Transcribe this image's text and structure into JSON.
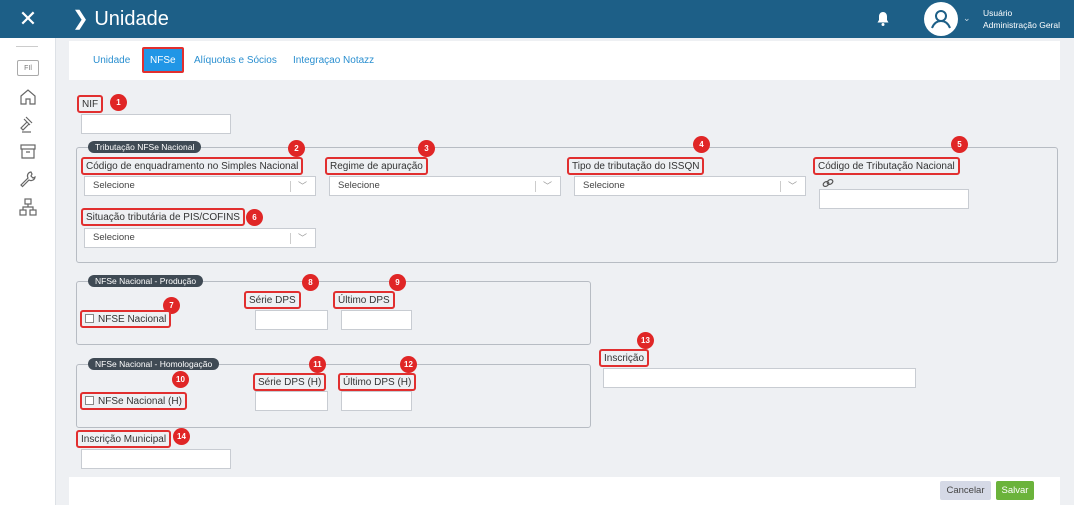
{
  "header": {
    "title": "Unidade",
    "user_name": "Usuário",
    "user_role": "Administração Geral"
  },
  "sidebar": {
    "fil_label": "FIl",
    "icons": [
      "home-icon",
      "gavel-icon",
      "archive-icon",
      "wrench-icon",
      "network-icon"
    ]
  },
  "tabs": [
    {
      "label": "Unidade"
    },
    {
      "label": "NFSe",
      "active": true
    },
    {
      "label": "Alíquotas e Sócios"
    },
    {
      "label": "Integraçao Notazz"
    }
  ],
  "form": {
    "nif": {
      "label": "NIF",
      "badge": "1",
      "value": ""
    },
    "tributacao": {
      "legend": "Tributação NFSe Nacional",
      "enquadramento": {
        "label": "Código de enquadramento no Simples Nacional",
        "badge": "2",
        "selected": "Selecione"
      },
      "regime": {
        "label": "Regime de apuração",
        "badge": "3",
        "selected": "Selecione"
      },
      "tipo_issqn": {
        "label": "Tipo de tributação do ISSQN",
        "badge": "4",
        "selected": "Selecione"
      },
      "codigo_nacional": {
        "label": "Código de Tributação Nacional",
        "badge": "5",
        "value": ""
      },
      "situacao_pis": {
        "label": "Situação tributária de PIS/COFINS",
        "badge": "6",
        "selected": "Selecione"
      }
    },
    "producao": {
      "legend": "NFSe Nacional - Produção",
      "nfse_nacional": {
        "label": "NFSE Nacional",
        "badge": "7",
        "checked": false
      },
      "serie_dps": {
        "label": "Série DPS",
        "badge": "8",
        "value": ""
      },
      "ultimo_dps": {
        "label": "Último DPS",
        "badge": "9",
        "value": ""
      }
    },
    "homologacao": {
      "legend": "NFSe Nacional - Homologação",
      "nfse_nacional_h": {
        "label": "NFSe Nacional (H)",
        "badge": "10",
        "checked": false
      },
      "serie_dps_h": {
        "label": "Série DPS (H)",
        "badge": "11",
        "value": ""
      },
      "ultimo_dps_h": {
        "label": "Último DPS (H)",
        "badge": "12",
        "value": ""
      }
    },
    "inscricao": {
      "label": "Inscrição",
      "badge": "13",
      "value": ""
    },
    "inscricao_municipal": {
      "label": "Inscrição Municipal",
      "badge": "14",
      "value": ""
    }
  },
  "footer": {
    "cancel_label": "Cancelar",
    "save_label": "Salvar"
  },
  "colors": {
    "header": "#1d5f87",
    "badge": "#e02626",
    "tab_active": "#2196e6",
    "save": "#6bb33b"
  }
}
